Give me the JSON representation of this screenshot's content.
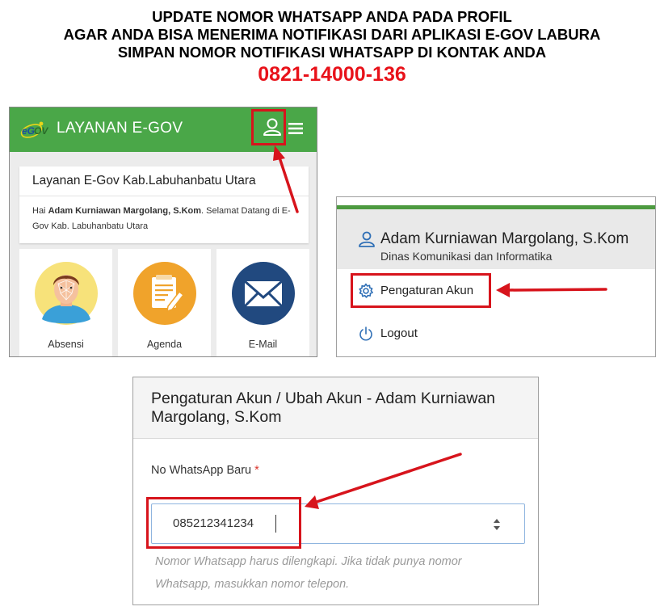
{
  "instructions": {
    "line1": "UPDATE NOMOR WHATSAPP ANDA PADA PROFIL",
    "line2": "AGAR ANDA BISA MENERIMA NOTIFIKASI DARI APLIKASI E-GOV LABURA",
    "line3": "SIMPAN NOMOR NOTIFIKASI WHATSAPP DI KONTAK ANDA",
    "phone": "0821-14000-136"
  },
  "app": {
    "title": "LAYANAN E-GOV",
    "logo_icon": "egov-logo-icon",
    "user_icon": "user-icon",
    "menu_icon": "hamburger-menu-icon",
    "bar_color": "#4aa748",
    "welcome": {
      "title": "Layanan E-Gov Kab.Labuhanbatu Utara",
      "greeting": "Hai ",
      "user_name": "Adam Kurniawan Margolang, S.Kom",
      "message": ". Selamat Datang di E-Gov Kab. Labuhanbatu Utara"
    },
    "tiles": [
      {
        "label": "Absensi",
        "icon": "face-recognition-icon",
        "color": "#f7e27a"
      },
      {
        "label": "Agenda",
        "icon": "notepad-pencil-icon",
        "color": "#f0a32b"
      },
      {
        "label": "E-Mail",
        "icon": "envelope-icon",
        "color": "#21497f"
      }
    ]
  },
  "dropdown": {
    "user_name": "Adam Kurniawan Margolang, S.Kom",
    "department": "Dinas Komunikasi dan Informatika",
    "items": [
      {
        "label": "Pengaturan Akun",
        "icon": "gear-icon"
      },
      {
        "label": "Logout",
        "icon": "power-icon"
      }
    ]
  },
  "form": {
    "title": "Pengaturan Akun / Ubah Akun - Adam Kurniawan Margolang, S.Kom",
    "field_label": "No WhatsApp Baru",
    "required_mark": "*",
    "field_value": "085212341234",
    "help_text": "Nomor Whatsapp harus dilengkapi. Jika tidak punya nomor Whatsapp, masukkan nomor telepon."
  },
  "colors": {
    "highlight": "#d7141c",
    "phone_text": "#e8121a",
    "required": "#d9342b"
  }
}
